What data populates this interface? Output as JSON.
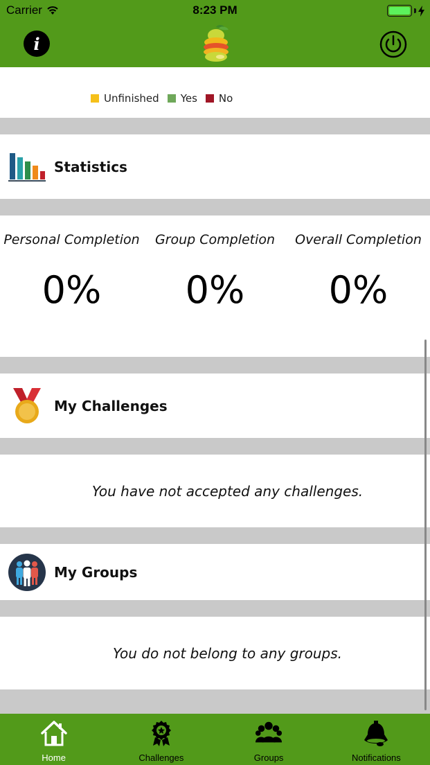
{
  "status_bar": {
    "carrier": "Carrier",
    "time": "8:23 PM"
  },
  "nav_bar": {
    "left_icon": "info-icon",
    "center_icon": "fruit-logo-icon",
    "right_icon": "power-icon",
    "info_glyph": "i"
  },
  "chart_legend": [
    {
      "label": "Unfinished",
      "color": "#f5c01a"
    },
    {
      "label": "Yes",
      "color": "#6fa85a"
    },
    {
      "label": "No",
      "color": "#a01626"
    }
  ],
  "statistics": {
    "title": "Statistics",
    "icon": "bar-chart-icon",
    "columns": [
      {
        "label": "Personal Completion",
        "value": "0%"
      },
      {
        "label": "Group Completion",
        "value": "0%"
      },
      {
        "label": "Overall Completion",
        "value": "0%"
      }
    ]
  },
  "my_challenges": {
    "title": "My Challenges",
    "icon": "medal-icon",
    "empty_message": "You have not accepted any challenges."
  },
  "my_groups": {
    "title": "My Groups",
    "icon": "people-icon",
    "empty_message": "You do not belong to any groups."
  },
  "tab_bar": {
    "active": "Home",
    "tabs": [
      {
        "label": "Home",
        "icon": "home-icon"
      },
      {
        "label": "Challenges",
        "icon": "badge-icon"
      },
      {
        "label": "Groups",
        "icon": "groups-icon"
      },
      {
        "label": "Notifications",
        "icon": "bell-icon"
      }
    ]
  },
  "colors": {
    "brand_green": "#529a1a",
    "separator_gray": "#c9c9c9",
    "active_tab_text": "#ffffff"
  }
}
